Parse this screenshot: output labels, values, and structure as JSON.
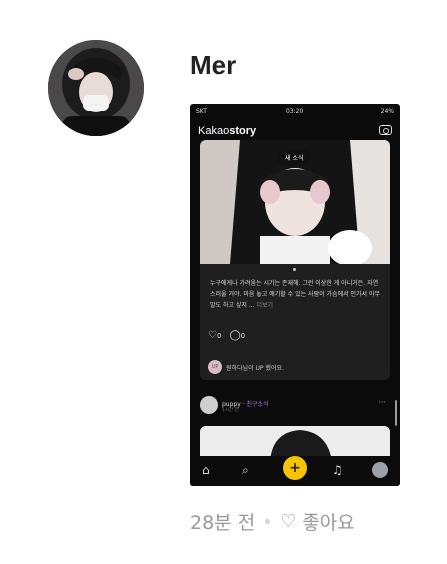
{
  "post": {
    "author": "Mer",
    "meta": {
      "time_ago": "28분 전",
      "like_label": "좋아요"
    }
  },
  "screenshot": {
    "status": {
      "signal": "SKT",
      "time": "03:20",
      "battery": "24%"
    },
    "app": {
      "logo_prefix": "Kakao",
      "logo_bold": "story"
    },
    "story_card": {
      "pill": "새 소식",
      "caption": "누구에게나 가려움는 시기는 존재해. 그런 이상한 게 아니거든. 자연스러울 거야. 마음 놓고 얘기할 수 있는 사람이 가슴에서 인가서 아무 말도 하고 싶지 ...",
      "more_label": "더보기",
      "like_count": "0",
      "comment_count": "0",
      "liker_initials": "UP",
      "liker_text": "원하다님이 UP 했어요."
    },
    "post2": {
      "name": "puppy",
      "relation": "· 친구소식",
      "time": "1시간 전",
      "more": "···"
    },
    "tabbar": {
      "plus_label": "+"
    }
  },
  "colors": {
    "accent_yellow": "#f7c400",
    "background": "#ffffff",
    "phone_bg": "#0b0b0b",
    "meta_gray": "#9a9a9a"
  }
}
